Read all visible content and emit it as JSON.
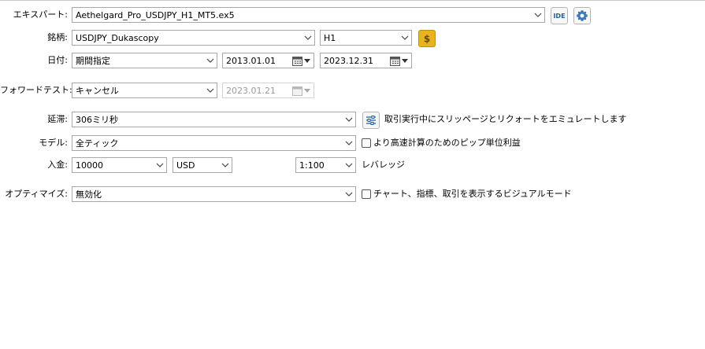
{
  "expert": {
    "label": "エキスパート:",
    "value": "Aethelgard_Pro_USDJPY_H1_MT5.ex5",
    "ide_label": "IDE",
    "icons": [
      "ide-icon",
      "gear-icon"
    ]
  },
  "symbol": {
    "label": "銘柄:",
    "value": "USDJPY_Dukascopy",
    "timeframe": "H1",
    "icons": [
      "dollar-icon"
    ]
  },
  "date": {
    "label": "日付:",
    "mode": "期間指定",
    "from": "2013.01.01",
    "to": "2023.12.31"
  },
  "forward": {
    "label": "フォワードテスト:",
    "value": "キャンセル",
    "date": "2023.01.21"
  },
  "delay": {
    "label": "延滞:",
    "value": "306ミリ秒",
    "description": "取引実行中にスリッページとリクォートをエミュレートします",
    "icons": [
      "sliders-icon"
    ]
  },
  "model": {
    "label": "モデル:",
    "value": "全ティック",
    "checkbox_label": "より高速計算のためのピップ単位利益",
    "checked": false
  },
  "deposit": {
    "label": "入金:",
    "amount": "10000",
    "currency": "USD",
    "leverage": "1:100",
    "leverage_label": "レバレッジ"
  },
  "optimization": {
    "label": "オプティマイズ:",
    "value": "無効化",
    "checkbox_label": "チャート、指標、取引を表示するビジュアルモード",
    "checked": false
  },
  "colors": {
    "border": "#a8a8a8",
    "icon_blue": "#1f5f99",
    "dollar_gold": "#e8b320"
  }
}
